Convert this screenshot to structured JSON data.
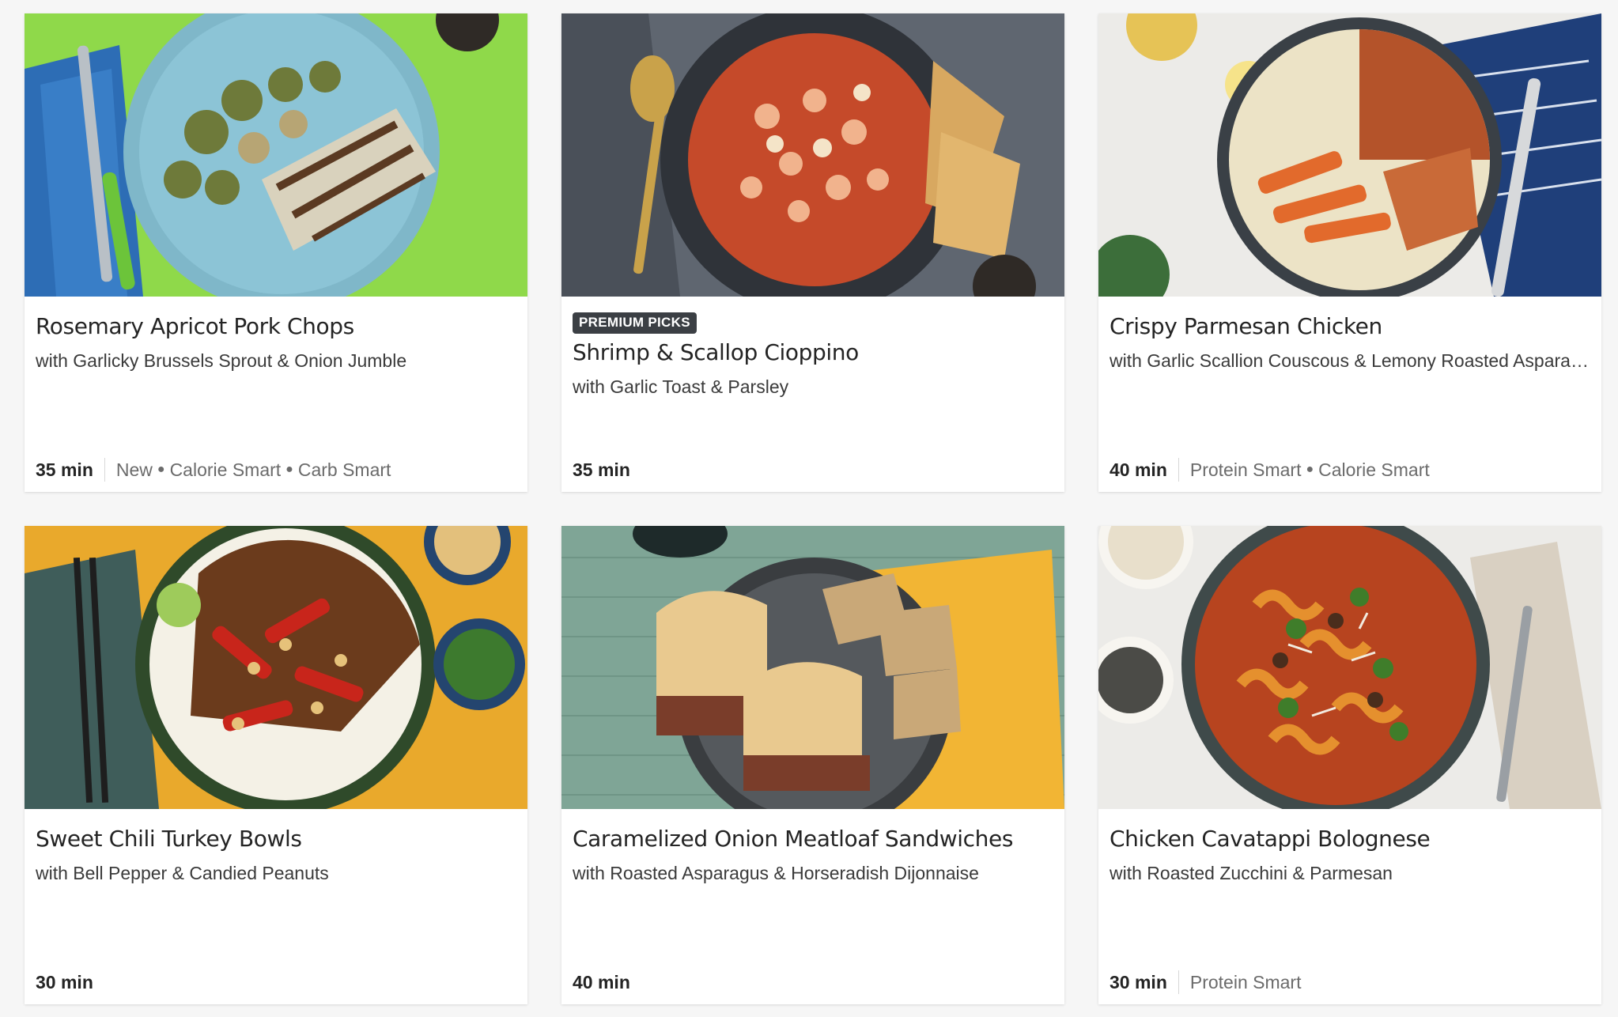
{
  "recipes": [
    {
      "title": "Rosemary Apricot Pork Chops",
      "subtitle": "with Garlicky Brussels Sprout & Onion Jumble",
      "badge": "",
      "time": "35 min",
      "tags": [
        "New",
        "Calorie Smart",
        "Carb Smart"
      ],
      "photo_bg": "#8fd94a"
    },
    {
      "title": "Shrimp & Scallop Cioppino",
      "subtitle": "with Garlic Toast & Parsley",
      "badge": "PREMIUM PICKS",
      "time": "35 min",
      "tags": [],
      "photo_bg": "#5f6670"
    },
    {
      "title": "Crispy Parmesan Chicken",
      "subtitle": "with Garlic Scallion Couscous & Lemony Roasted Asparagus",
      "badge": "",
      "time": "40 min",
      "tags": [
        "Protein Smart",
        "Calorie Smart"
      ],
      "photo_bg": "#ecebe8"
    },
    {
      "title": "Sweet Chili Turkey Bowls",
      "subtitle": "with Bell Pepper & Candied Peanuts",
      "badge": "",
      "time": "30 min",
      "tags": [],
      "photo_bg": "#e9a92c"
    },
    {
      "title": "Caramelized Onion Meatloaf Sandwiches",
      "subtitle": "with Roasted Asparagus & Horseradish Dijonnaise",
      "badge": "",
      "time": "40 min",
      "tags": [],
      "photo_bg": "#7fa596"
    },
    {
      "title": "Chicken Cavatappi Bolognese",
      "subtitle": "with Roasted Zucchini & Parmesan",
      "badge": "",
      "time": "30 min",
      "tags": [
        "Protein Smart"
      ],
      "photo_bg": "#ecebe8"
    }
  ]
}
